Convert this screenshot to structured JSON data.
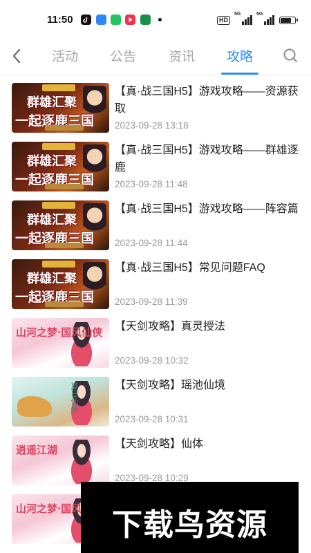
{
  "status_bar": {
    "time": "11:50",
    "hd_label": "HD",
    "signal1_label": "5G",
    "signal2_label": "5G",
    "battery_level": 0.85,
    "app_icons": [
      "tiktok-icon",
      "blue-app-icon",
      "message-icon",
      "video-icon",
      "oppo-icon"
    ]
  },
  "nav": {
    "tabs": [
      {
        "label": "活动",
        "active": false
      },
      {
        "label": "公告",
        "active": false
      },
      {
        "label": "资讯",
        "active": false
      },
      {
        "label": "攻略",
        "active": true
      }
    ],
    "accent_color": "#2f8bf0"
  },
  "articles": [
    {
      "title": "【真·战三国H5】游戏攻略——资源获取",
      "date": "2023-09-28 13:18",
      "thumb_style": "red",
      "thumb_text1": "群雄汇聚",
      "thumb_text2": "一起逐鹿三国"
    },
    {
      "title": "【真·战三国H5】游戏攻略——群雄逐鹿",
      "date": "2023-09-28 11:48",
      "thumb_style": "red",
      "thumb_text1": "群雄汇聚",
      "thumb_text2": "一起逐鹿三国"
    },
    {
      "title": "【真·战三国H5】游戏攻略——阵容篇",
      "date": "2023-09-28 11:44",
      "thumb_style": "red",
      "thumb_text1": "群雄汇聚",
      "thumb_text2": "一起逐鹿三国"
    },
    {
      "title": "【真·战三国H5】常见问题FAQ",
      "date": "2023-09-28 11:39",
      "thumb_style": "red",
      "thumb_text1": "群雄汇聚",
      "thumb_text2": "一起逐鹿三国"
    },
    {
      "title": "【天剑攻略】真灵授法",
      "date": "2023-09-28 10:32",
      "thumb_style": "pink",
      "thumb_text1": "山河之梦·国风仙侠"
    },
    {
      "title": "【天剑攻略】瑶池仙境",
      "date": "2023-09-28 10:31",
      "thumb_style": "green",
      "thumb_text1": "夏日仙侠"
    },
    {
      "title": "【天剑攻略】仙体",
      "date": "2023-09-28 10:29",
      "thumb_style": "pink",
      "thumb_text1": "逍遥江湖"
    },
    {
      "title": "",
      "date": "",
      "thumb_style": "pink",
      "thumb_text1": "山河之梦·国风仙侠"
    }
  ],
  "watermark": {
    "text": "下载鸟资源"
  }
}
